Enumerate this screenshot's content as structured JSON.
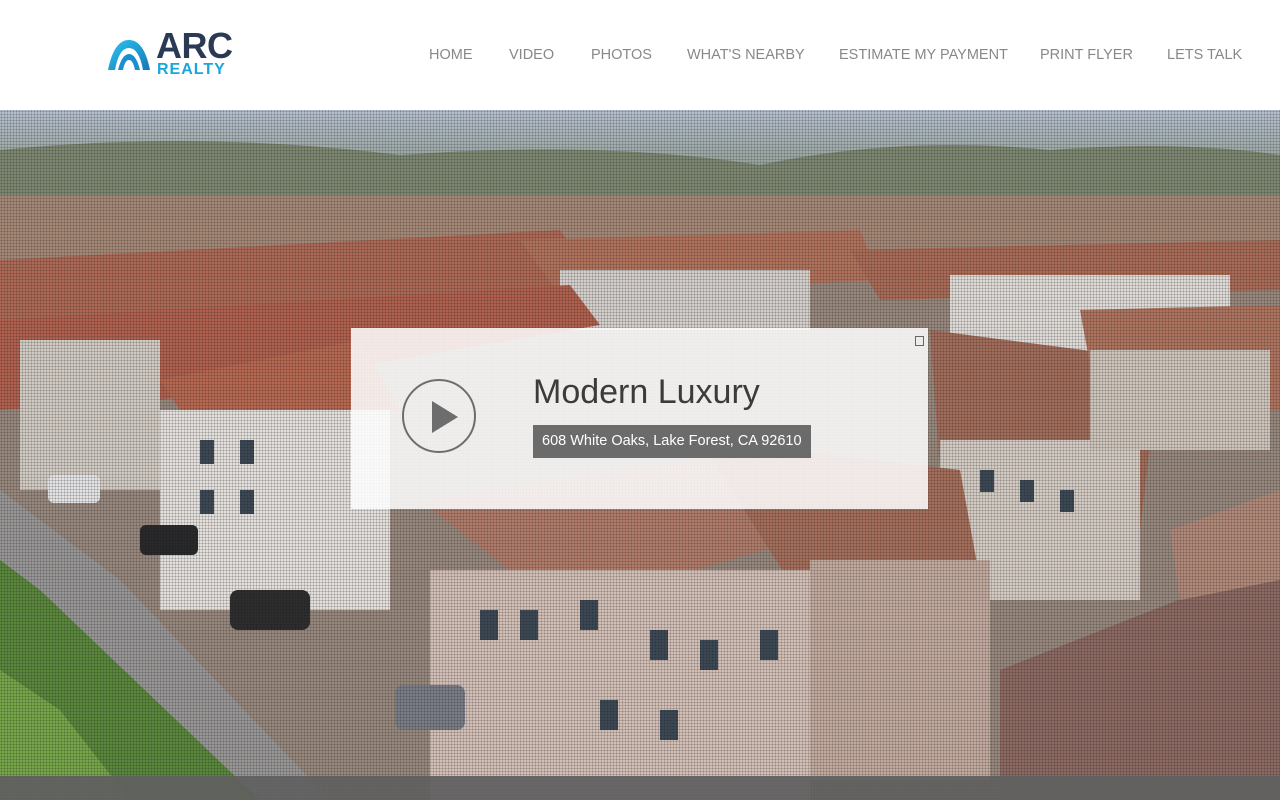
{
  "brand": {
    "name": "ARC",
    "sub": "REALTY"
  },
  "nav": [
    {
      "label": "HOME"
    },
    {
      "label": "VIDEO"
    },
    {
      "label": "PHOTOS"
    },
    {
      "label": "WHAT'S NEARBY"
    },
    {
      "label": "ESTIMATE MY PAYMENT"
    },
    {
      "label": "PRINT FLYER"
    },
    {
      "label": "LETS TALK"
    }
  ],
  "listing": {
    "title": "Modern Luxury",
    "address": "608 White Oaks, Lake Forest, CA 92610"
  },
  "icons": {
    "play": "play-icon",
    "close": "close-icon"
  },
  "colors": {
    "brand_dark": "#2a3a55",
    "brand_blue": "#1aa6dc",
    "nav_text": "#888888"
  }
}
